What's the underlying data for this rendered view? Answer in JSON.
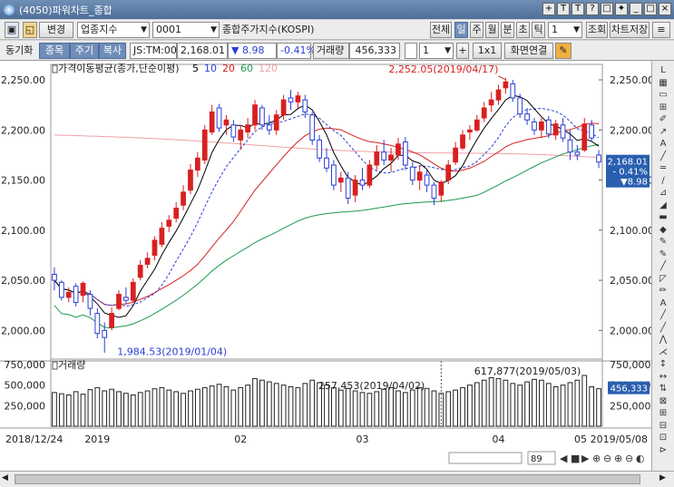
{
  "window": {
    "title": "(4050)파워차트_종합",
    "controls": [
      "+",
      "T",
      "T",
      "?",
      "□",
      "✦",
      "_",
      "□",
      "×"
    ]
  },
  "toolbar1": {
    "change_label": "변경",
    "category_value": "업종지수",
    "code_value": "0001",
    "name_label": "종합주가지수(KOSPI)",
    "period_tabs": [
      "전체",
      "일",
      "주",
      "월",
      "분",
      "초",
      "틱"
    ],
    "period_count": "1",
    "lookup_label": "조회",
    "save_label": "차트저장"
  },
  "toolbar2": {
    "sync_label": "동기화",
    "tabs": [
      "종목",
      "주기",
      "복사"
    ],
    "ticker": "JS:TM:00",
    "price": "2,168.01",
    "change": "▼ 8.98",
    "pct": "-0.41%",
    "vol_label": "거래량",
    "volume": "456,333",
    "page_value": "1",
    "plus": "+",
    "ratio": "1x1",
    "link_label": "화면연결"
  },
  "price_panel": {
    "indicator_title": "가격이동평균(종가,단순이평)",
    "ma": [
      {
        "label": "5",
        "color": "#000000"
      },
      {
        "label": "10",
        "color": "#2a3fd4"
      },
      {
        "label": "20",
        "color": "#d82020"
      },
      {
        "label": "60",
        "color": "#1a9a4a"
      },
      {
        "label": "120",
        "color": "#f0a0a8"
      }
    ],
    "high_annotation": "2,252.05(2019/04/17)",
    "low_annotation": "1,984.53(2019/01/04)",
    "last_box": [
      "2,168.01",
      "- 0.41%",
      "▼8.98"
    ],
    "y_ticks": [
      "2,250.00",
      "2,200.00",
      "2,150.00",
      "2,100.00",
      "2,050.00",
      "2,000.00"
    ]
  },
  "volume_panel": {
    "title": "거래량",
    "y_ticks": [
      "750,000",
      "500,000",
      "250,000"
    ],
    "annotation_left": "257,453(2019/04/02)",
    "annotation_top": "617,877(2019/05/03)",
    "last_box": "456,333"
  },
  "x_axis": {
    "start": "2018/12/24",
    "end": "2019/05/08",
    "ticks": [
      "2019",
      "02",
      "03",
      "04",
      "05"
    ]
  },
  "navigator": {
    "count": "89"
  },
  "colors": {
    "up": "#d82020",
    "down": "#2a3fd4"
  },
  "chart_data": {
    "type": "candlestick",
    "ylim": [
      1975,
      2260
    ],
    "candles": [
      [
        2056,
        2063,
        2040,
        2050
      ],
      [
        2048,
        2050,
        2030,
        2033
      ],
      [
        2033,
        2043,
        2028,
        2038
      ],
      [
        2044,
        2047,
        2024,
        2028
      ],
      [
        2035,
        2049,
        2028,
        2047
      ],
      [
        2036,
        2040,
        2015,
        2022
      ],
      [
        2017,
        2022,
        1992,
        1997
      ],
      [
        2000,
        2008,
        1985,
        1993
      ],
      [
        2003,
        2023,
        2000,
        2017
      ],
      [
        2022,
        2040,
        2020,
        2036
      ],
      [
        2033,
        2043,
        2026,
        2030
      ],
      [
        2030,
        2052,
        2028,
        2048
      ],
      [
        2053,
        2070,
        2050,
        2065
      ],
      [
        2066,
        2078,
        2062,
        2072
      ],
      [
        2075,
        2094,
        2070,
        2090
      ],
      [
        2086,
        2108,
        2083,
        2102
      ],
      [
        2104,
        2115,
        2098,
        2110
      ],
      [
        2112,
        2128,
        2108,
        2122
      ],
      [
        2125,
        2145,
        2120,
        2138
      ],
      [
        2140,
        2166,
        2136,
        2160
      ],
      [
        2160,
        2178,
        2153,
        2172
      ],
      [
        2170,
        2205,
        2166,
        2200
      ],
      [
        2198,
        2225,
        2195,
        2218
      ],
      [
        2222,
        2226,
        2198,
        2202
      ],
      [
        2205,
        2215,
        2195,
        2210
      ],
      [
        2205,
        2210,
        2188,
        2193
      ],
      [
        2190,
        2205,
        2180,
        2200
      ],
      [
        2198,
        2212,
        2192,
        2205
      ],
      [
        2205,
        2230,
        2200,
        2225
      ],
      [
        2222,
        2225,
        2200,
        2205
      ],
      [
        2205,
        2215,
        2195,
        2200
      ],
      [
        2200,
        2220,
        2195,
        2215
      ],
      [
        2215,
        2235,
        2210,
        2230
      ],
      [
        2232,
        2240,
        2220,
        2228
      ],
      [
        2228,
        2238,
        2222,
        2234
      ],
      [
        2230,
        2235,
        2212,
        2218
      ],
      [
        2215,
        2218,
        2185,
        2190
      ],
      [
        2190,
        2195,
        2168,
        2172
      ],
      [
        2172,
        2182,
        2158,
        2162
      ],
      [
        2165,
        2170,
        2140,
        2145
      ],
      [
        2148,
        2158,
        2138,
        2152
      ],
      [
        2152,
        2158,
        2126,
        2132
      ],
      [
        2135,
        2155,
        2128,
        2150
      ],
      [
        2150,
        2162,
        2140,
        2145
      ],
      [
        2145,
        2170,
        2142,
        2165
      ],
      [
        2165,
        2185,
        2160,
        2178
      ],
      [
        2178,
        2190,
        2165,
        2170
      ],
      [
        2170,
        2182,
        2158,
        2175
      ],
      [
        2175,
        2192,
        2170,
        2186
      ],
      [
        2188,
        2193,
        2160,
        2165
      ],
      [
        2163,
        2168,
        2145,
        2150
      ],
      [
        2150,
        2165,
        2140,
        2158
      ],
      [
        2155,
        2160,
        2138,
        2145
      ],
      [
        2145,
        2148,
        2125,
        2132
      ],
      [
        2135,
        2150,
        2128,
        2148
      ],
      [
        2150,
        2170,
        2146,
        2165
      ],
      [
        2168,
        2188,
        2165,
        2182
      ],
      [
        2182,
        2200,
        2180,
        2195
      ],
      [
        2198,
        2205,
        2190,
        2200
      ],
      [
        2200,
        2215,
        2198,
        2210
      ],
      [
        2212,
        2228,
        2208,
        2222
      ],
      [
        2225,
        2238,
        2218,
        2230
      ],
      [
        2230,
        2245,
        2225,
        2240
      ],
      [
        2242,
        2252,
        2236,
        2248
      ],
      [
        2246,
        2250,
        2228,
        2232
      ],
      [
        2232,
        2236,
        2212,
        2216
      ],
      [
        2216,
        2222,
        2205,
        2210
      ],
      [
        2208,
        2212,
        2195,
        2200
      ],
      [
        2200,
        2212,
        2192,
        2208
      ],
      [
        2210,
        2214,
        2192,
        2196
      ],
      [
        2195,
        2210,
        2190,
        2206
      ],
      [
        2205,
        2212,
        2188,
        2192
      ],
      [
        2190,
        2200,
        2170,
        2178
      ],
      [
        2178,
        2185,
        2170,
        2175
      ],
      [
        2180,
        2212,
        2178,
        2206
      ],
      [
        2205,
        2210,
        2188,
        2192
      ],
      [
        2175,
        2180,
        2162,
        2168
      ]
    ],
    "volume": [
      410,
      395,
      380,
      420,
      390,
      445,
      470,
      430,
      450,
      420,
      400,
      380,
      410,
      430,
      455,
      470,
      440,
      420,
      400,
      430,
      450,
      470,
      490,
      510,
      480,
      440,
      470,
      500,
      580,
      560,
      540,
      520,
      500,
      480,
      470,
      520,
      560,
      530,
      500,
      470,
      440,
      460,
      430,
      410,
      400,
      420,
      450,
      470,
      430,
      410,
      440,
      470,
      460,
      430,
      400,
      420,
      440,
      470,
      500,
      530,
      560,
      590,
      580,
      560,
      520,
      500,
      540,
      570,
      560,
      520,
      480,
      500,
      530,
      560,
      618,
      480,
      456
    ]
  }
}
